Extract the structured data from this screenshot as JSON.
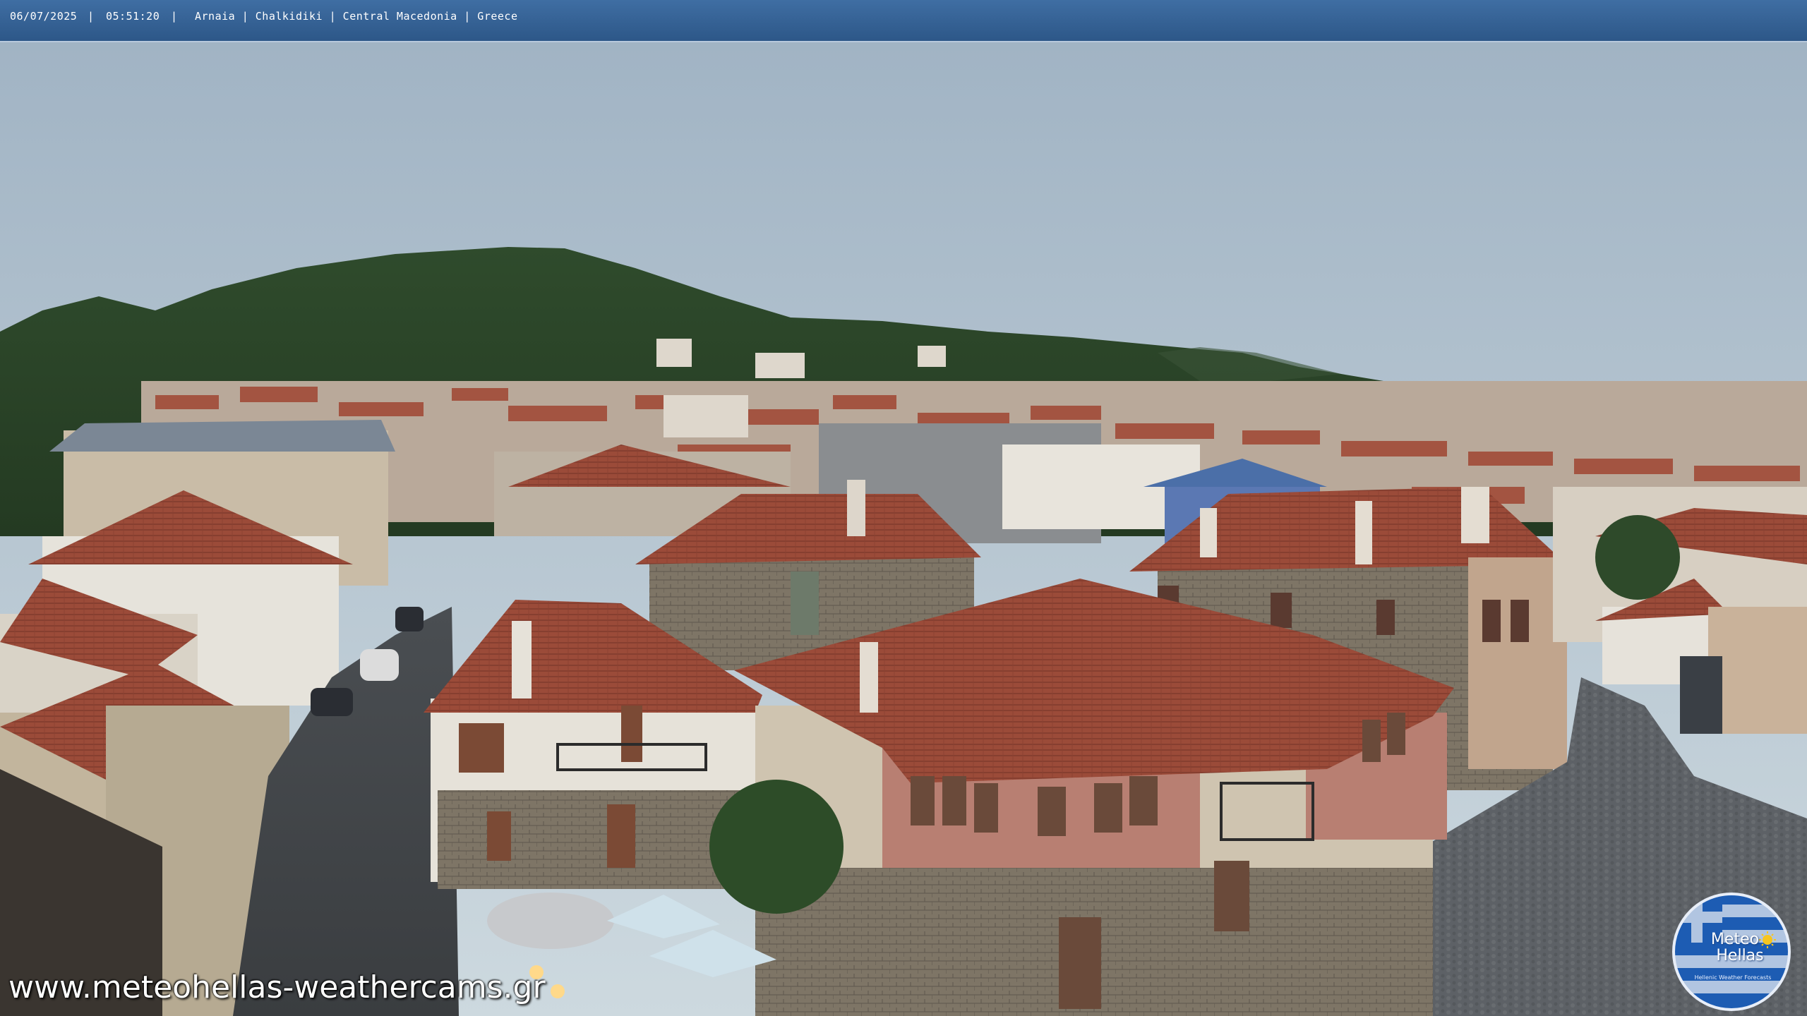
{
  "info_bar": {
    "date": "06/07/2025",
    "time": "05:51:20",
    "location": "Arnaia | Chalkidiki |  Central Macedonia | Greece"
  },
  "watermark": {
    "url": "www.meteohellas-weathercams.gr"
  },
  "logo": {
    "line1": "Meteo",
    "line2": "Hellas",
    "tagline": "Hellenic Weather Forecasts",
    "icon": "sun-icon",
    "flag_icon": "greek-flag-icon"
  },
  "colors": {
    "bar": "#2d5788",
    "sky_top": "#9fb2c3",
    "sky_bottom": "#cdd9df",
    "hill": "#2e4a2a",
    "roof": "#9a4a38"
  }
}
